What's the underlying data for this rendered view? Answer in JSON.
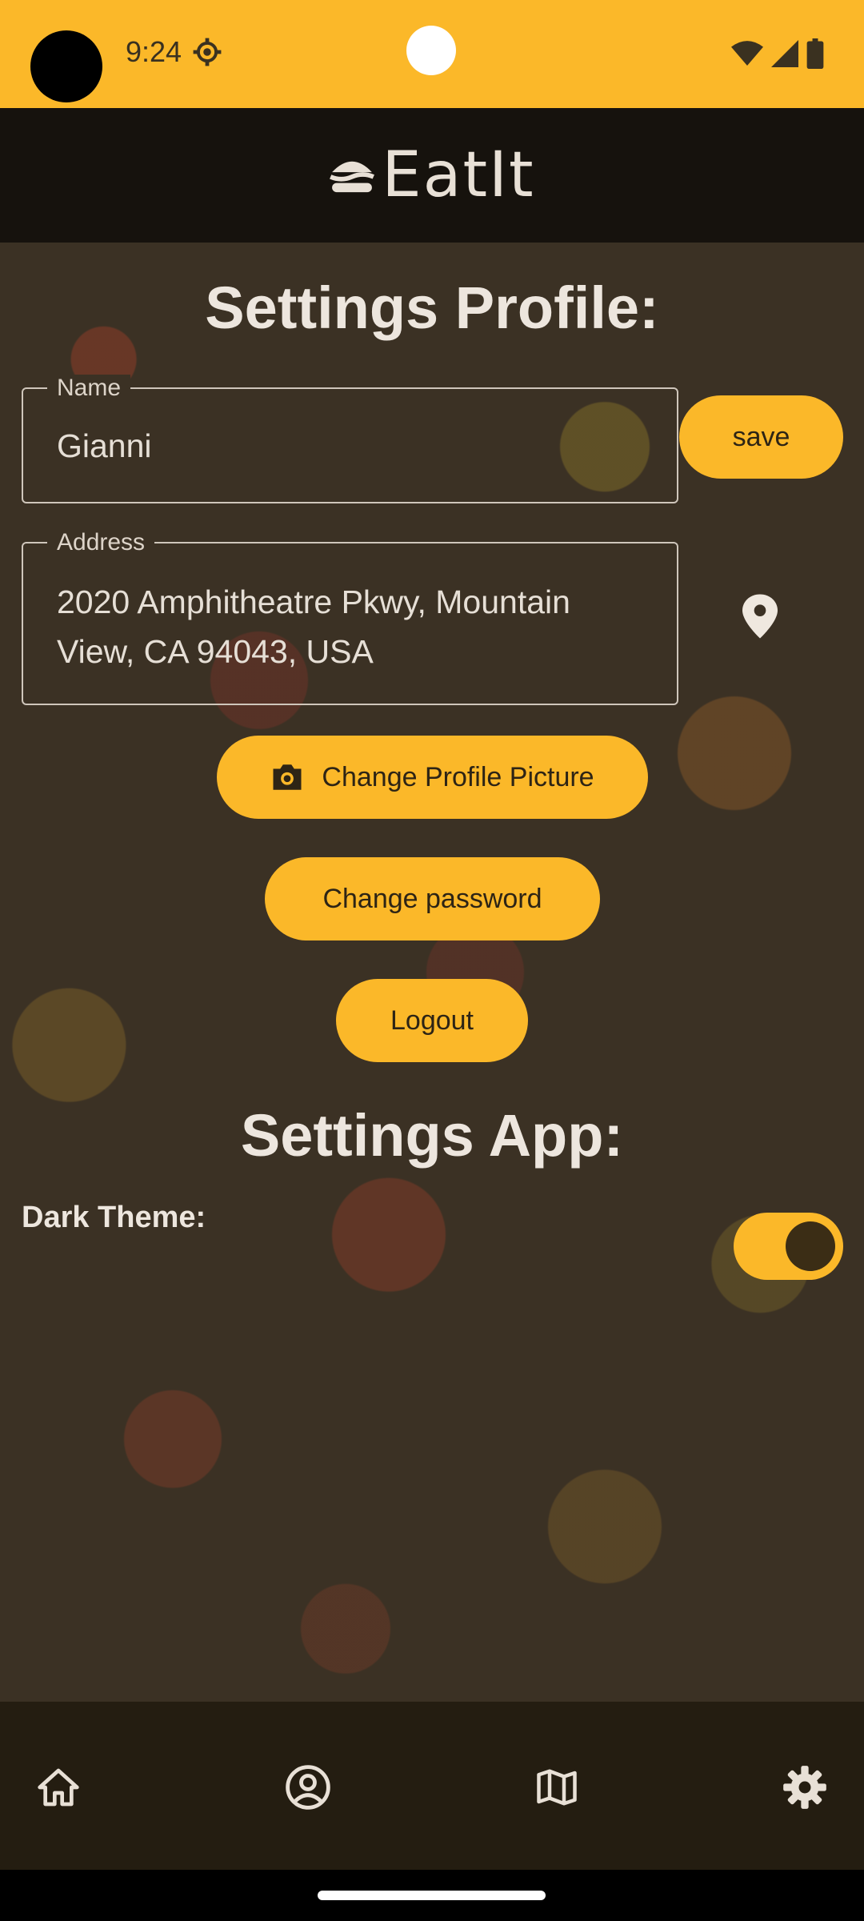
{
  "status_bar": {
    "time": "9:24",
    "bg_color": "#fbb829"
  },
  "header": {
    "app_name": "EatIt"
  },
  "profile": {
    "title": "Settings Profile:",
    "name_field": {
      "label": "Name",
      "value": "Gianni"
    },
    "save_label": "save",
    "address_field": {
      "label": "Address",
      "line1": "2020 Amphitheatre Pkwy, Mountain",
      "line2": "View, CA 94043, USA"
    },
    "change_picture_label": "Change Profile Picture",
    "change_password_label": "Change password",
    "logout_label": "Logout"
  },
  "app_settings": {
    "title": "Settings App:",
    "dark_theme_label": "Dark Theme:",
    "dark_theme_on": true
  },
  "bottom_nav": {
    "items": [
      "home-icon",
      "account-circle-icon",
      "map-icon",
      "settings-gear-icon"
    ]
  },
  "colors": {
    "accent": "#fbb829",
    "header_bg": "#16120d",
    "nav_bg": "#241d11"
  }
}
